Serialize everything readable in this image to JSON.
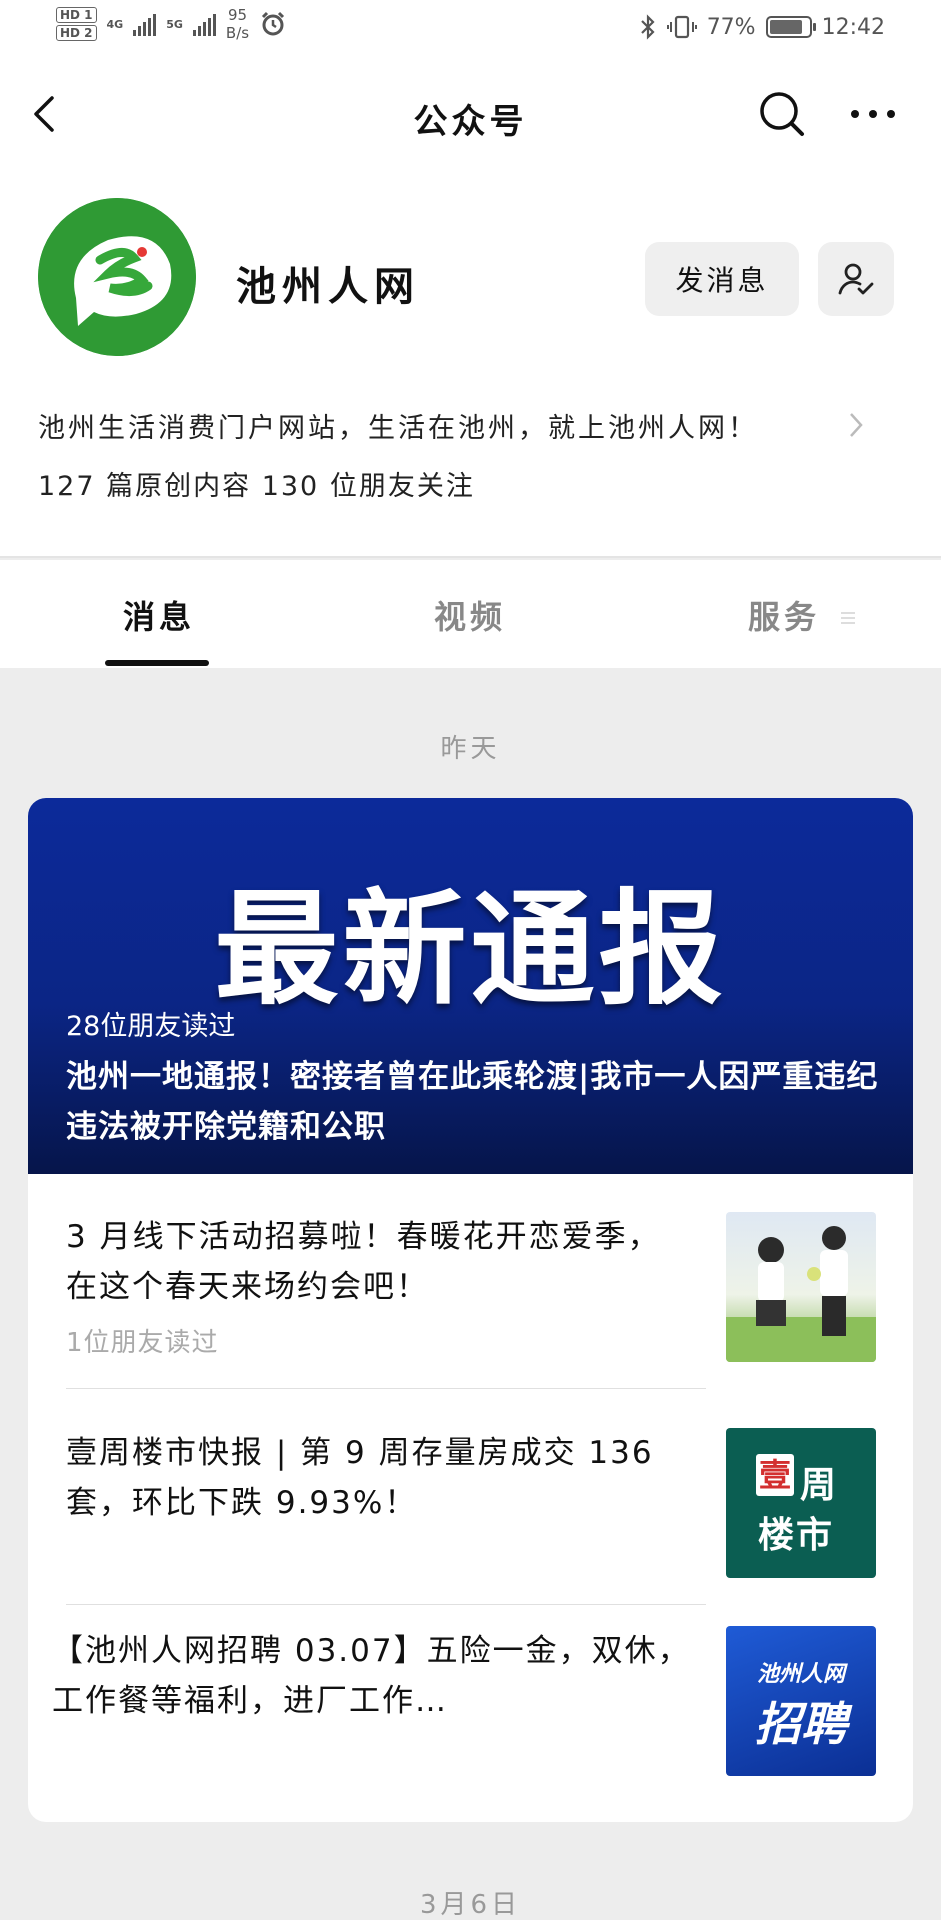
{
  "status_bar": {
    "hd1": "HD 1",
    "hd2": "HD 2",
    "net1": "4G",
    "net2": "5G",
    "speed_value": "95",
    "speed_unit": "B/s",
    "battery": "77%",
    "battery_level": 0.77,
    "time": "12:42"
  },
  "nav": {
    "title": "公众号"
  },
  "profile": {
    "name": "池州人网",
    "send_message_label": "发消息",
    "description": "池州生活消费门户网站，生活在池州，就上池州人网！",
    "stats": "127 篇原创内容   130 位朋友关注"
  },
  "tabs": {
    "messages": "消息",
    "videos": "视频",
    "services": "服务"
  },
  "feed": {
    "date_yesterday": "昨天",
    "date_next": "3月6日",
    "banner_text": "最新通报",
    "featured": {
      "readers": "28位朋友读过",
      "title": "池州一地通报！密接者曾在此乘轮渡|我市一人因严重违纪违法被开除党籍和公职"
    },
    "items": [
      {
        "title": "3 月线下活动招募啦！春暖花开恋爱季，在这个春天来场约会吧！",
        "readers": "1位朋友读过"
      },
      {
        "title": "壹周楼市快报 | 第 9 周存量房成交 136 套，环比下跌 9.93%！",
        "thumb_text_1": "壹",
        "thumb_text_2": "周",
        "thumb_text_3": "楼市"
      },
      {
        "title": "【池州人网招聘 03.07】五险一金，双休，工作餐等福利，进厂工作…",
        "thumb_text_1": "池州人网",
        "thumb_text_2": "招聘"
      }
    ]
  },
  "colors": {
    "brand_green": "#2f9a34",
    "banner_blue": "#0c2a9a",
    "thumb_teal": "#0b5e52"
  }
}
